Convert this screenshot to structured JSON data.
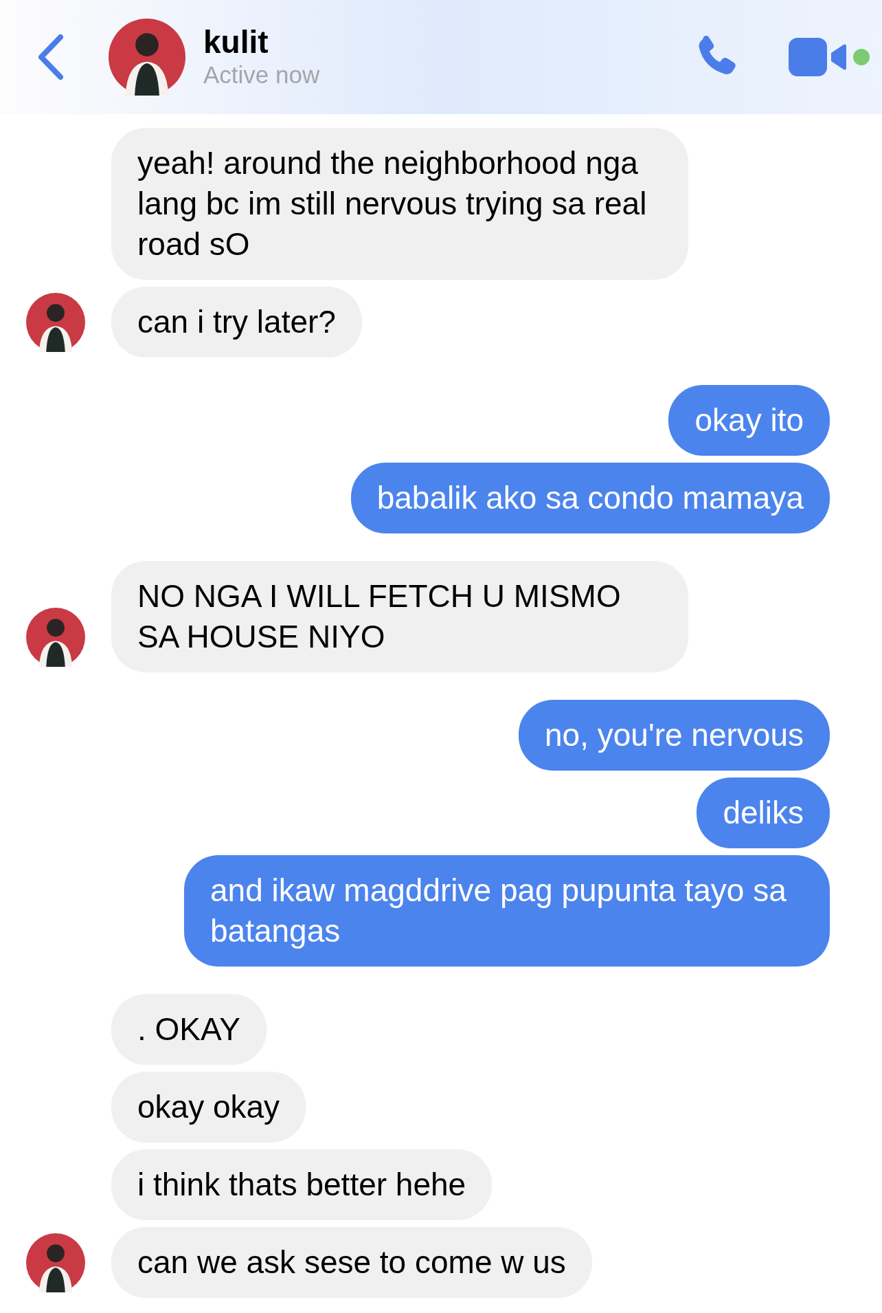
{
  "header": {
    "name": "kulit",
    "status": "Active now",
    "online": true
  },
  "groups": [
    {
      "kind": "received",
      "messages": [
        "yeah! around the neighborhood nga lang bc im still nervous trying sa real road sO",
        "can i try later?"
      ]
    },
    {
      "kind": "sent",
      "messages": [
        "okay ito",
        "babalik ako sa condo mamaya"
      ]
    },
    {
      "kind": "received",
      "messages": [
        "NO NGA I WILL FETCH U MISMO SA HOUSE NIYO"
      ]
    },
    {
      "kind": "sent",
      "messages": [
        "no, you're nervous",
        "deliks",
        "and ikaw magddrive pag pupunta tayo sa batangas"
      ]
    },
    {
      "kind": "received",
      "messages": [
        ". OKAY",
        "okay okay",
        "i think thats better hehe",
        "can we ask sese to come w us"
      ]
    }
  ]
}
